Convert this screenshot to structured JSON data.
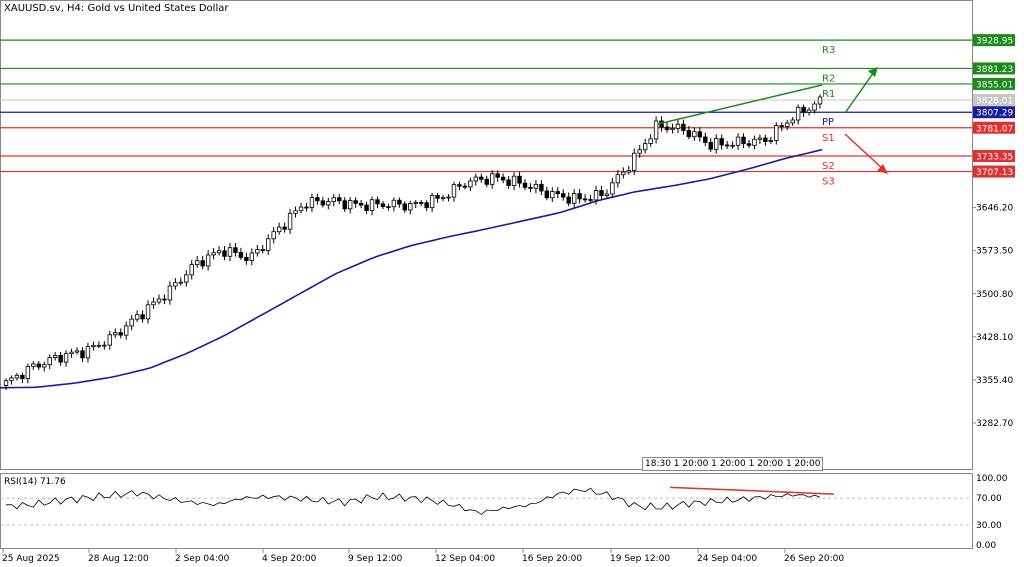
{
  "header": {
    "title": "XAUUSD.sv, H4:  Gold vs United States Dollar"
  },
  "rsi": {
    "title": "RSI(14) 71.76",
    "levels": [
      "100.00",
      "70.00",
      "30.00",
      "0.00"
    ]
  },
  "time_popup": "18:30  1 20:00  1 20:00 1 20:00 1 20:00",
  "colors": {
    "resistance": "#1a8a1a",
    "support": "#e03030",
    "pivot": "#1a1aa0",
    "ma": "#1a1aa0"
  },
  "chart_data": {
    "type": "candlestick",
    "symbol": "XAUUSD.sv",
    "timeframe": "H4",
    "ylim": [
      3210,
      3990
    ],
    "price_ticks": [
      "3282.70",
      "3355.40",
      "3428.10",
      "3500.80",
      "3573.50",
      "3646.20"
    ],
    "time_ticks": [
      "25 Aug 2025",
      "28 Aug 12:00",
      "2 Sep 04:00",
      "4 Sep 20:00",
      "9 Sep 12:00",
      "12 Sep 04:00",
      "16 Sep 20:00",
      "19 Sep 12:00",
      "24 Sep 04:00",
      "26 Sep 20:00"
    ],
    "levels": [
      {
        "name": "R3",
        "value": 3928.95,
        "label": "3928.95",
        "kind": "resistance"
      },
      {
        "name": "R2",
        "value": 3881.23,
        "label": "3881.23",
        "kind": "resistance"
      },
      {
        "name": "R1",
        "value": 3855.01,
        "label": "3855.01",
        "kind": "resistance"
      },
      {
        "name": "PP",
        "value": 3807.29,
        "label": "3807.29",
        "kind": "pivot"
      },
      {
        "name": "S1",
        "value": 3781.07,
        "label": "3781.07",
        "kind": "support"
      },
      {
        "name": "S2",
        "value": 3733.35,
        "label": "3733.35",
        "kind": "support"
      },
      {
        "name": "S3",
        "value": 3707.13,
        "label": "3707.13",
        "kind": "support"
      }
    ],
    "current_price": {
      "value": 3828.01,
      "label": "3828.01"
    },
    "ma_anchors": [
      3342,
      3343,
      3350,
      3360,
      3375,
      3400,
      3430,
      3465,
      3500,
      3535,
      3562,
      3582,
      3597,
      3610,
      3624,
      3638,
      3658,
      3673,
      3683,
      3695,
      3711,
      3729,
      3744
    ],
    "close_anchors": [
      3350,
      3378,
      3395,
      3405,
      3430,
      3468,
      3505,
      3552,
      3575,
      3560,
      3608,
      3654,
      3658,
      3650,
      3652,
      3650,
      3662,
      3690,
      3697,
      3687,
      3670,
      3660,
      3668,
      3720,
      3785,
      3778,
      3752,
      3756,
      3760,
      3800,
      3826
    ],
    "rsi_anchors": [
      58,
      60,
      66,
      70,
      74,
      78,
      70,
      64,
      60,
      70,
      72,
      70,
      66,
      64,
      72,
      71,
      68,
      60,
      48,
      55,
      60,
      76,
      83,
      74,
      58,
      56,
      62,
      65,
      68,
      72,
      75,
      72
    ]
  }
}
